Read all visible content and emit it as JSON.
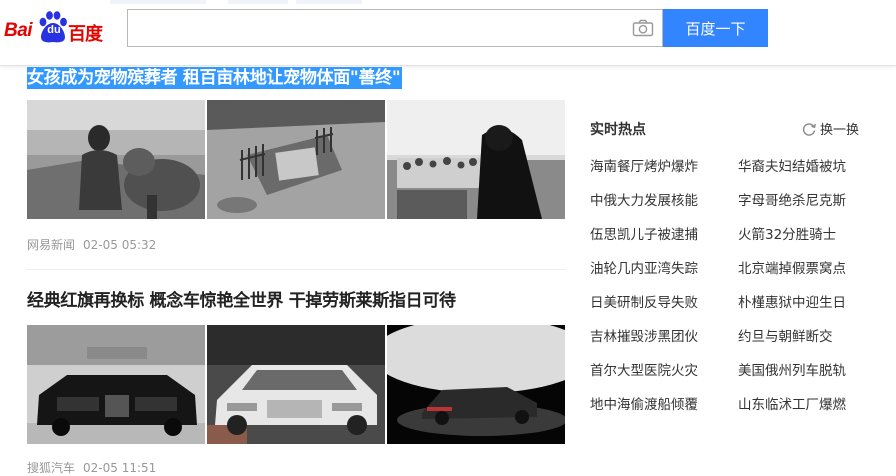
{
  "header": {
    "logo": {
      "bai": "Bai",
      "du": "du",
      "cn": "百度"
    },
    "search": {
      "value": "",
      "placeholder": ""
    },
    "search_button_label": "百度一下",
    "camera_icon": "camera-icon"
  },
  "articles": [
    {
      "title": "女孩成为宠物殡葬者 租百亩林地让宠物体面\"善终\"",
      "selected": true,
      "source": "网易新闻",
      "time": "02-05 05:32",
      "images": [
        "girl-with-dog-photo",
        "pet-grave-fence-photo",
        "woman-at-memorial-photo"
      ]
    },
    {
      "title": "经典红旗再换标 概念车惊艳全世界 干掉劳斯莱斯指日可待",
      "selected": false,
      "source": "搜狐汽车",
      "time": "02-05 11:51",
      "images": [
        "black-hongqi-sedan-photo",
        "white-hongqi-car-photo",
        "concept-car-photo"
      ]
    }
  ],
  "hot": {
    "title": "实时热点",
    "refresh_label": "换一换",
    "items": [
      "海南餐厅烤炉爆炸",
      "华裔夫妇结婚被坑",
      "中俄大力发展核能",
      "字母哥绝杀尼克斯",
      "伍思凯儿子被逮捕",
      "火箭32分胜骑士",
      "油轮几内亚湾失踪",
      "北京端掉假票窝点",
      "日美研制反导失败",
      "朴槿惠狱中迎生日",
      "吉林摧毁涉黑团伙",
      "约旦与朝鲜断交",
      "首尔大型医院火灾",
      "美国俄州列车脱轨",
      "地中海偷渡船倾覆",
      "山东临沭工厂爆燃"
    ]
  },
  "colors": {
    "brand_red": "#e10601",
    "brand_blue": "#2932e1",
    "search_button": "#3385ff",
    "selection": "#3399ff"
  }
}
